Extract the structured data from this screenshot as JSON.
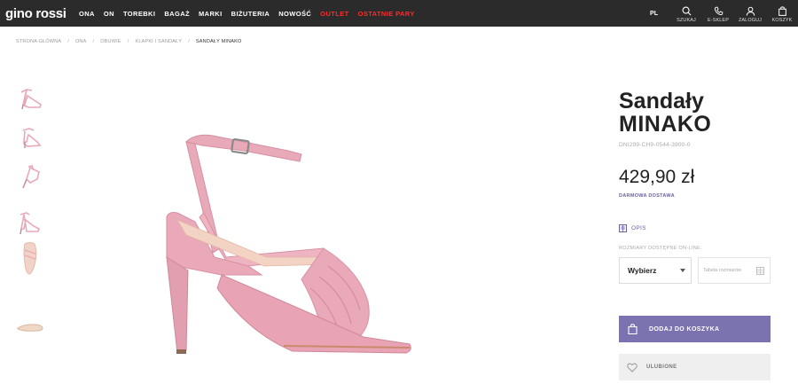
{
  "header": {
    "logo": "gino rossi",
    "nav": [
      {
        "label": "ONA",
        "highlight": false
      },
      {
        "label": "ON",
        "highlight": false
      },
      {
        "label": "TOREBKI",
        "highlight": false
      },
      {
        "label": "BAGAŻ",
        "highlight": false
      },
      {
        "label": "MARKI",
        "highlight": false
      },
      {
        "label": "BIŻUTERIA",
        "highlight": false
      },
      {
        "label": "NOWOŚĆ",
        "highlight": false
      },
      {
        "label": "OUTLET",
        "highlight": true
      },
      {
        "label": "OSTATNIE PARY",
        "highlight": true
      }
    ],
    "lang": "PL",
    "tools": [
      {
        "label": "SZUKAJ",
        "icon": "search-icon"
      },
      {
        "label": "E-SKLEP",
        "icon": "phone-icon"
      },
      {
        "label": "ZALOGUJ",
        "icon": "user-icon"
      },
      {
        "label": "KOSZYK",
        "icon": "cart-icon"
      }
    ]
  },
  "breadcrumb": [
    "STRONA GŁÓWNA",
    "ONA",
    "OBUWIE",
    "KLAPKI I SANDAŁY",
    "SANDAŁY MINAKO"
  ],
  "product": {
    "title_line1": "Sandały",
    "title_line2": "MINAKO",
    "sku": "DNI299-CH9-0544-3900-0",
    "price": "429,90 zł",
    "shipping": "DARMOWA DOSTAWA",
    "description_label": "OPIS",
    "sizes_label": "ROZMIARY DOSTĘPNE ON-LINE:",
    "size_select": "Wybierz",
    "size_table": "Tabela rozmiarów",
    "add_to_cart": "DODAJ DO KOSZYKA",
    "favorite": "ULUBIONE"
  },
  "colors": {
    "topbar": "#2b2b2b",
    "accent": "#7b72b0",
    "sale_red": "#ff2a2a",
    "shoe_pink": "#e8a9b8"
  }
}
